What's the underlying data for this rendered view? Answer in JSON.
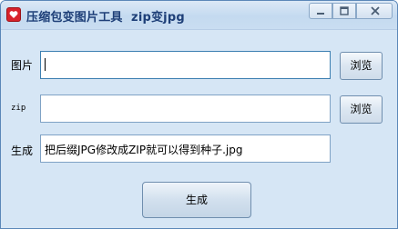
{
  "window": {
    "title": "压缩包变图片工具  zip变jpg"
  },
  "form": {
    "image": {
      "label": "图片",
      "value": "",
      "browse_label": "浏览"
    },
    "zip": {
      "label": "zip",
      "value": "",
      "browse_label": "浏览"
    },
    "output": {
      "label": "生成",
      "value": "把后缀JPG修改成ZIP就可以得到种子.jpg"
    },
    "generate_label": "生成"
  },
  "icons": {
    "app": "heart-icon",
    "minimize": "minimize-icon",
    "maximize": "maximize-icon",
    "close": "close-icon"
  },
  "colors": {
    "app_icon": "#d8222a",
    "title_text": "#1e3f78",
    "window_bg": "#d6e6f5"
  }
}
